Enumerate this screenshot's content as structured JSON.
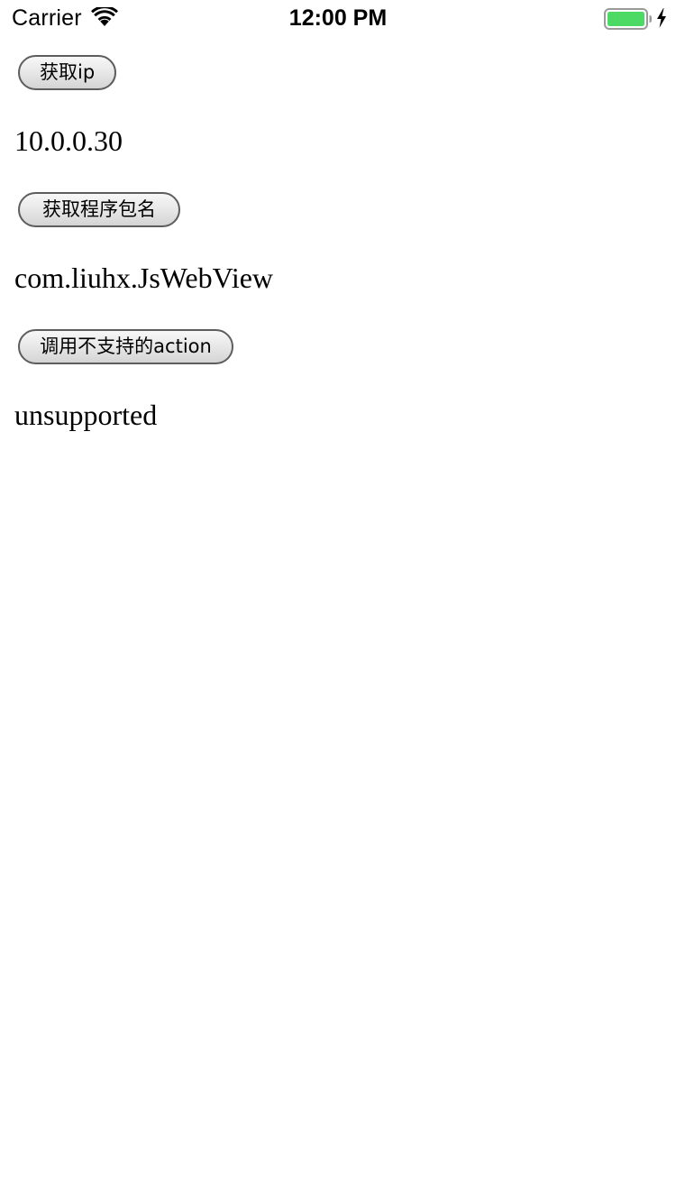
{
  "status_bar": {
    "carrier": "Carrier",
    "time": "12:00 PM",
    "battery_color": "#4cd964",
    "icons": [
      "wifi-icon",
      "battery-icon",
      "charging-icon"
    ]
  },
  "actions": [
    {
      "button_label": "获取ip",
      "result": "10.0.0.30"
    },
    {
      "button_label": "获取程序包名",
      "result": "com.liuhx.JsWebView"
    },
    {
      "button_label": "调用不支持的action",
      "result": "unsupported"
    }
  ]
}
